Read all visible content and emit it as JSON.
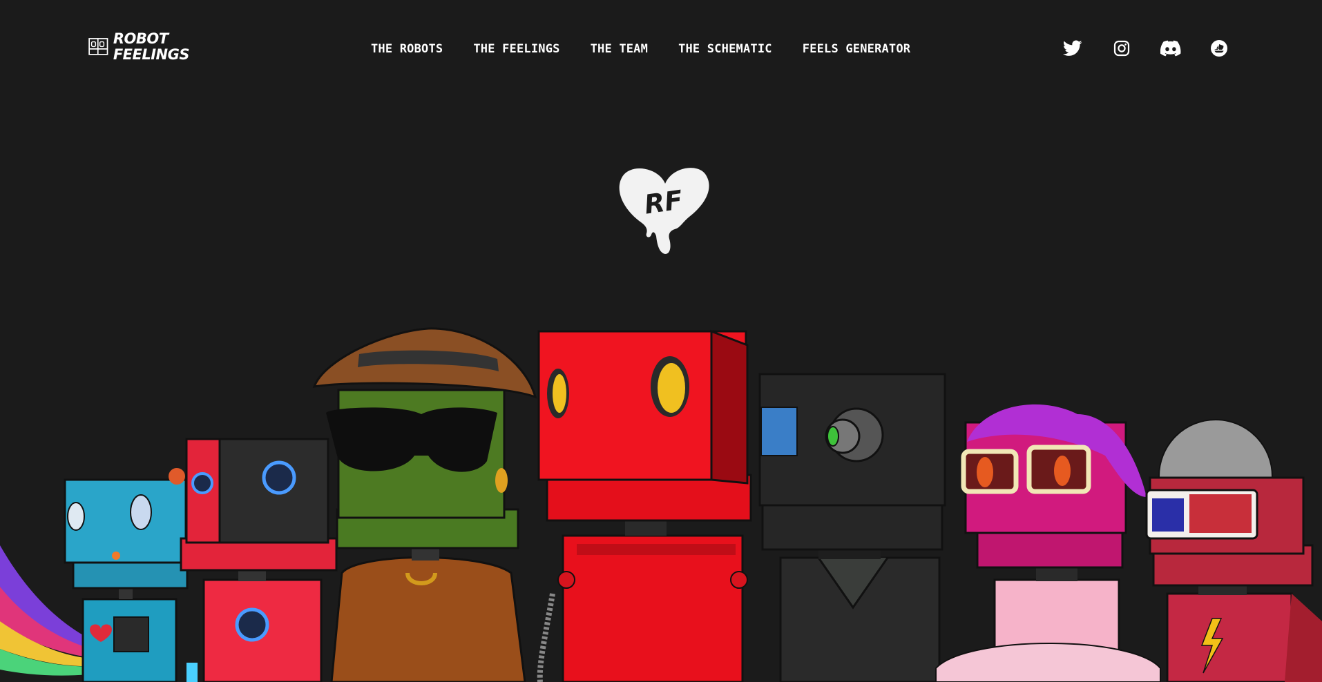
{
  "header": {
    "logo": {
      "line1": "ROBOT",
      "line2": "FEELINGS"
    },
    "nav": [
      {
        "label": "THE ROBOTS"
      },
      {
        "label": "THE FEELINGS"
      },
      {
        "label": "THE TEAM"
      },
      {
        "label": "THE SCHEMATIC"
      },
      {
        "label": "FEELS GENERATOR"
      }
    ],
    "social": [
      {
        "icon": "twitter-icon"
      },
      {
        "icon": "instagram-icon"
      },
      {
        "icon": "discord-icon"
      },
      {
        "icon": "opensea-icon"
      }
    ]
  },
  "hero": {
    "emblem_text": "RF",
    "robots": [
      {
        "name": "robot-cyan",
        "color": "#2aa5c9"
      },
      {
        "name": "robot-red-cyborg",
        "color": "#e3243a"
      },
      {
        "name": "robot-green-detective",
        "color": "#4d7a22"
      },
      {
        "name": "robot-red-center",
        "color": "#e8101c"
      },
      {
        "name": "robot-black-camera",
        "color": "#262626"
      },
      {
        "name": "robot-pink-glasses",
        "color": "#d11a7e"
      },
      {
        "name": "robot-3d-glasses",
        "color": "#b8283d"
      }
    ]
  },
  "colors": {
    "background": "#1b1b1b",
    "text": "#ffffff"
  }
}
